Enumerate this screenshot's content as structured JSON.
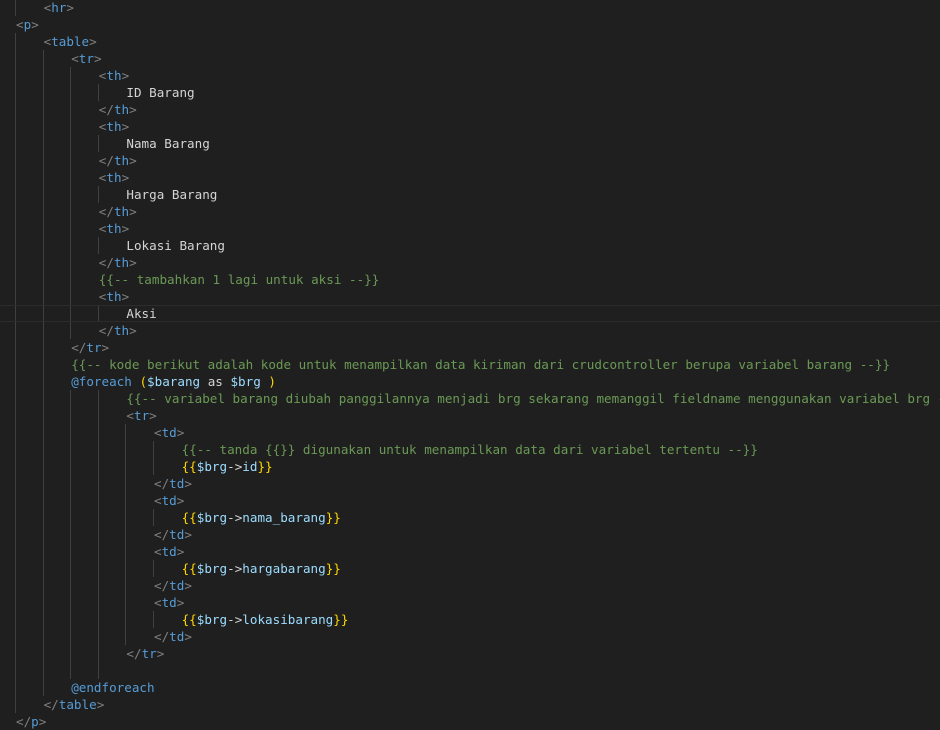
{
  "colors": {
    "background": "#1f1f1f",
    "tag": "#569cd6",
    "bracket": "#808080",
    "text": "#d4d4d4",
    "comment": "#6a9955",
    "variable": "#9cdcfe",
    "brace_gold": "#ffd700",
    "brace_purple": "#da70d6"
  },
  "code_lines": [
    {
      "indent": 3,
      "tokens": [
        {
          "t": "<",
          "c": "tok-bracket"
        },
        {
          "t": "hr",
          "c": "tok-tag"
        },
        {
          "t": ">",
          "c": "tok-bracket"
        }
      ]
    },
    {
      "indent": 1,
      "tokens": [
        {
          "t": "<",
          "c": "tok-bracket"
        },
        {
          "t": "p",
          "c": "tok-tag"
        },
        {
          "t": ">",
          "c": "tok-bracket"
        }
      ]
    },
    {
      "indent": 3,
      "tokens": [
        {
          "t": "<",
          "c": "tok-bracket"
        },
        {
          "t": "table",
          "c": "tok-tag"
        },
        {
          "t": ">",
          "c": "tok-bracket"
        }
      ]
    },
    {
      "indent": 5,
      "tokens": [
        {
          "t": "<",
          "c": "tok-bracket"
        },
        {
          "t": "tr",
          "c": "tok-tag"
        },
        {
          "t": ">",
          "c": "tok-bracket"
        }
      ]
    },
    {
      "indent": 7,
      "tokens": [
        {
          "t": "<",
          "c": "tok-bracket"
        },
        {
          "t": "th",
          "c": "tok-tag"
        },
        {
          "t": ">",
          "c": "tok-bracket"
        }
      ]
    },
    {
      "indent": 9,
      "tokens": [
        {
          "t": "ID Barang",
          "c": "tok-text"
        }
      ]
    },
    {
      "indent": 7,
      "tokens": [
        {
          "t": "</",
          "c": "tok-bracket"
        },
        {
          "t": "th",
          "c": "tok-tag"
        },
        {
          "t": ">",
          "c": "tok-bracket"
        }
      ]
    },
    {
      "indent": 7,
      "tokens": [
        {
          "t": "<",
          "c": "tok-bracket"
        },
        {
          "t": "th",
          "c": "tok-tag"
        },
        {
          "t": ">",
          "c": "tok-bracket"
        }
      ]
    },
    {
      "indent": 9,
      "tokens": [
        {
          "t": "Nama Barang",
          "c": "tok-text"
        }
      ]
    },
    {
      "indent": 7,
      "tokens": [
        {
          "t": "</",
          "c": "tok-bracket"
        },
        {
          "t": "th",
          "c": "tok-tag"
        },
        {
          "t": ">",
          "c": "tok-bracket"
        }
      ]
    },
    {
      "indent": 7,
      "tokens": [
        {
          "t": "<",
          "c": "tok-bracket"
        },
        {
          "t": "th",
          "c": "tok-tag"
        },
        {
          "t": ">",
          "c": "tok-bracket"
        }
      ]
    },
    {
      "indent": 9,
      "tokens": [
        {
          "t": "Harga Barang",
          "c": "tok-text"
        }
      ]
    },
    {
      "indent": 7,
      "tokens": [
        {
          "t": "</",
          "c": "tok-bracket"
        },
        {
          "t": "th",
          "c": "tok-tag"
        },
        {
          "t": ">",
          "c": "tok-bracket"
        }
      ]
    },
    {
      "indent": 7,
      "tokens": [
        {
          "t": "<",
          "c": "tok-bracket"
        },
        {
          "t": "th",
          "c": "tok-tag"
        },
        {
          "t": ">",
          "c": "tok-bracket"
        }
      ]
    },
    {
      "indent": 9,
      "tokens": [
        {
          "t": "Lokasi Barang",
          "c": "tok-text"
        }
      ]
    },
    {
      "indent": 7,
      "tokens": [
        {
          "t": "</",
          "c": "tok-bracket"
        },
        {
          "t": "th",
          "c": "tok-tag"
        },
        {
          "t": ">",
          "c": "tok-bracket"
        }
      ]
    },
    {
      "indent": 7,
      "tokens": [
        {
          "t": "{{-- tambahkan 1 lagi untuk aksi --}}",
          "c": "tok-comment"
        }
      ]
    },
    {
      "indent": 7,
      "tokens": [
        {
          "t": "<",
          "c": "tok-bracket"
        },
        {
          "t": "th",
          "c": "tok-tag"
        },
        {
          "t": ">",
          "c": "tok-bracket"
        }
      ]
    },
    {
      "indent": 9,
      "current": true,
      "tokens": [
        {
          "t": "Aksi",
          "c": "tok-text"
        }
      ]
    },
    {
      "indent": 7,
      "tokens": [
        {
          "t": "</",
          "c": "tok-bracket"
        },
        {
          "t": "th",
          "c": "tok-tag"
        },
        {
          "t": ">",
          "c": "tok-bracket"
        }
      ]
    },
    {
      "indent": 5,
      "tokens": [
        {
          "t": "</",
          "c": "tok-bracket"
        },
        {
          "t": "tr",
          "c": "tok-tag"
        },
        {
          "t": ">",
          "c": "tok-bracket"
        }
      ]
    },
    {
      "indent": 5,
      "tokens": [
        {
          "t": "{{-- kode berikut adalah kode untuk menampilkan data kiriman dari crudcontroller berupa variabel barang --}}",
          "c": "tok-comment"
        }
      ]
    },
    {
      "indent": 5,
      "tokens": [
        {
          "t": "@foreach",
          "c": "tok-keyword"
        },
        {
          "t": " (",
          "c": "tok-brace1"
        },
        {
          "t": "$barang",
          "c": "tok-var"
        },
        {
          "t": " as ",
          "c": "tok-text"
        },
        {
          "t": "$brg",
          "c": "tok-var"
        },
        {
          "t": " )",
          "c": "tok-brace1"
        }
      ]
    },
    {
      "indent": 9,
      "tokens": [
        {
          "t": "{{-- variabel barang diubah panggilannya menjadi brg sekarang memanggil fieldname menggunakan variabel brg --}}",
          "c": "tok-comment"
        }
      ]
    },
    {
      "indent": 9,
      "tokens": [
        {
          "t": "<",
          "c": "tok-bracket"
        },
        {
          "t": "tr",
          "c": "tok-tag"
        },
        {
          "t": ">",
          "c": "tok-bracket"
        }
      ]
    },
    {
      "indent": 11,
      "tokens": [
        {
          "t": "<",
          "c": "tok-bracket"
        },
        {
          "t": "td",
          "c": "tok-tag"
        },
        {
          "t": ">",
          "c": "tok-bracket"
        }
      ]
    },
    {
      "indent": 13,
      "tokens": [
        {
          "t": "{{-- tanda {{}} digunakan untuk menampilkan data dari variabel tertentu --}}",
          "c": "tok-comment"
        }
      ]
    },
    {
      "indent": 13,
      "tokens": [
        {
          "t": "{{",
          "c": "tok-brace1"
        },
        {
          "t": "$brg",
          "c": "tok-var"
        },
        {
          "t": "->",
          "c": "tok-arrow"
        },
        {
          "t": "id",
          "c": "tok-var"
        },
        {
          "t": "}}",
          "c": "tok-brace1"
        }
      ]
    },
    {
      "indent": 11,
      "tokens": [
        {
          "t": "</",
          "c": "tok-bracket"
        },
        {
          "t": "td",
          "c": "tok-tag"
        },
        {
          "t": ">",
          "c": "tok-bracket"
        }
      ]
    },
    {
      "indent": 11,
      "tokens": [
        {
          "t": "<",
          "c": "tok-bracket"
        },
        {
          "t": "td",
          "c": "tok-tag"
        },
        {
          "t": ">",
          "c": "tok-bracket"
        }
      ]
    },
    {
      "indent": 13,
      "tokens": [
        {
          "t": "{{",
          "c": "tok-brace1"
        },
        {
          "t": "$brg",
          "c": "tok-var"
        },
        {
          "t": "->",
          "c": "tok-arrow"
        },
        {
          "t": "nama_barang",
          "c": "tok-var"
        },
        {
          "t": "}}",
          "c": "tok-brace1"
        }
      ]
    },
    {
      "indent": 11,
      "tokens": [
        {
          "t": "</",
          "c": "tok-bracket"
        },
        {
          "t": "td",
          "c": "tok-tag"
        },
        {
          "t": ">",
          "c": "tok-bracket"
        }
      ]
    },
    {
      "indent": 11,
      "tokens": [
        {
          "t": "<",
          "c": "tok-bracket"
        },
        {
          "t": "td",
          "c": "tok-tag"
        },
        {
          "t": ">",
          "c": "tok-bracket"
        }
      ]
    },
    {
      "indent": 13,
      "tokens": [
        {
          "t": "{{",
          "c": "tok-brace1"
        },
        {
          "t": "$brg",
          "c": "tok-var"
        },
        {
          "t": "->",
          "c": "tok-arrow"
        },
        {
          "t": "hargabarang",
          "c": "tok-var"
        },
        {
          "t": "}}",
          "c": "tok-brace1"
        }
      ]
    },
    {
      "indent": 11,
      "tokens": [
        {
          "t": "</",
          "c": "tok-bracket"
        },
        {
          "t": "td",
          "c": "tok-tag"
        },
        {
          "t": ">",
          "c": "tok-bracket"
        }
      ]
    },
    {
      "indent": 11,
      "tokens": [
        {
          "t": "<",
          "c": "tok-bracket"
        },
        {
          "t": "td",
          "c": "tok-tag"
        },
        {
          "t": ">",
          "c": "tok-bracket"
        }
      ]
    },
    {
      "indent": 13,
      "tokens": [
        {
          "t": "{{",
          "c": "tok-brace1"
        },
        {
          "t": "$brg",
          "c": "tok-var"
        },
        {
          "t": "->",
          "c": "tok-arrow"
        },
        {
          "t": "lokasibarang",
          "c": "tok-var"
        },
        {
          "t": "}}",
          "c": "tok-brace1"
        }
      ]
    },
    {
      "indent": 11,
      "tokens": [
        {
          "t": "</",
          "c": "tok-bracket"
        },
        {
          "t": "td",
          "c": "tok-tag"
        },
        {
          "t": ">",
          "c": "tok-bracket"
        }
      ]
    },
    {
      "indent": 9,
      "tokens": [
        {
          "t": "</",
          "c": "tok-bracket"
        },
        {
          "t": "tr",
          "c": "tok-tag"
        },
        {
          "t": ">",
          "c": "tok-bracket"
        }
      ]
    },
    {
      "indent": 0,
      "tokens": []
    },
    {
      "indent": 5,
      "tokens": [
        {
          "t": "@endforeach",
          "c": "tok-keyword"
        }
      ]
    },
    {
      "indent": 3,
      "tokens": [
        {
          "t": "</",
          "c": "tok-bracket"
        },
        {
          "t": "table",
          "c": "tok-tag"
        },
        {
          "t": ">",
          "c": "tok-bracket"
        }
      ]
    },
    {
      "indent": 1,
      "tokens": [
        {
          "t": "</",
          "c": "tok-bracket"
        },
        {
          "t": "p",
          "c": "tok-tag"
        },
        {
          "t": ">",
          "c": "tok-bracket"
        }
      ]
    }
  ]
}
